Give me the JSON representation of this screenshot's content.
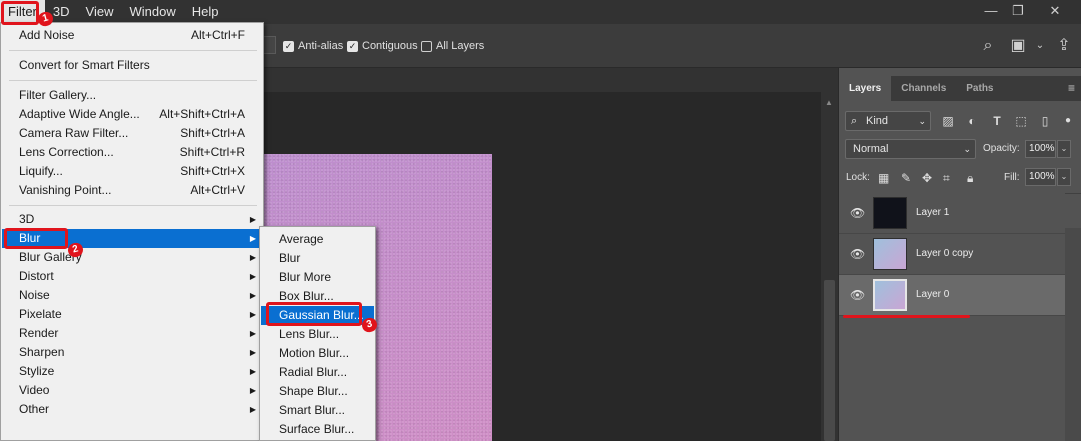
{
  "menubar": {
    "items": [
      "Filter",
      "3D",
      "View",
      "Window",
      "Help"
    ],
    "window_controls": [
      "—",
      "❐",
      "✕"
    ]
  },
  "options": {
    "anti_alias": "Anti-alias",
    "contiguous": "Contiguous",
    "all_layers": "All Layers",
    "anti_alias_checked": true,
    "contiguous_checked": true,
    "all_layers_checked": false
  },
  "filter_menu": {
    "items": [
      {
        "label": "Add Noise",
        "shortcut": "Alt+Ctrl+F"
      },
      {
        "label": "Convert for Smart Filters",
        "shortcut": ""
      },
      {
        "label": "Filter Gallery...",
        "shortcut": ""
      },
      {
        "label": "Adaptive Wide Angle...",
        "shortcut": "Alt+Shift+Ctrl+A"
      },
      {
        "label": "Camera Raw Filter...",
        "shortcut": "Shift+Ctrl+A"
      },
      {
        "label": "Lens Correction...",
        "shortcut": "Shift+Ctrl+R"
      },
      {
        "label": "Liquify...",
        "shortcut": "Shift+Ctrl+X"
      },
      {
        "label": "Vanishing Point...",
        "shortcut": "Alt+Ctrl+V"
      },
      {
        "label": "3D",
        "shortcut": ""
      },
      {
        "label": "Blur",
        "shortcut": ""
      },
      {
        "label": "Blur Gallery",
        "shortcut": ""
      },
      {
        "label": "Distort",
        "shortcut": ""
      },
      {
        "label": "Noise",
        "shortcut": ""
      },
      {
        "label": "Pixelate",
        "shortcut": ""
      },
      {
        "label": "Render",
        "shortcut": ""
      },
      {
        "label": "Sharpen",
        "shortcut": ""
      },
      {
        "label": "Stylize",
        "shortcut": ""
      },
      {
        "label": "Video",
        "shortcut": ""
      },
      {
        "label": "Other",
        "shortcut": ""
      }
    ]
  },
  "blur_submenu": {
    "items": [
      "Average",
      "Blur",
      "Blur More",
      "Box Blur...",
      "Gaussian Blur...",
      "Lens Blur...",
      "Motion Blur...",
      "Radial Blur...",
      "Shape Blur...",
      "Smart Blur...",
      "Surface Blur..."
    ]
  },
  "layers_panel": {
    "tabs": [
      "Layers",
      "Channels",
      "Paths"
    ],
    "kind_label": "Kind",
    "blend_mode": "Normal",
    "opacity_label": "Opacity:",
    "opacity_value": "100%",
    "lock_label": "Lock:",
    "fill_label": "Fill:",
    "fill_value": "100%",
    "layers": [
      {
        "name": "Layer 1",
        "thumb_color": "#10121a"
      },
      {
        "name": "Layer 0 copy",
        "thumb_color": "#b4b6dc"
      },
      {
        "name": "Layer 0",
        "thumb_color": "#b4b6dc"
      }
    ]
  },
  "annotations": [
    "1",
    "2",
    "3"
  ]
}
